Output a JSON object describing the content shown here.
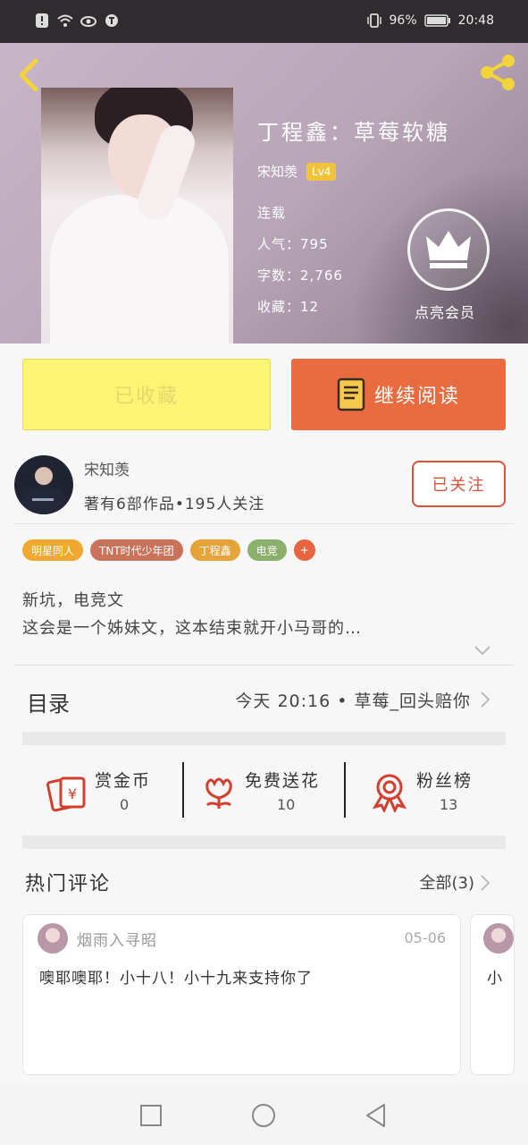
{
  "status_bar": {
    "battery": "96%",
    "time": "20:48"
  },
  "book": {
    "title": "丁程鑫：草莓软糖",
    "author": "宋知羡",
    "level": "Lv4",
    "status": "连载",
    "popularity": "人气：795",
    "word_count": "字数：2,766",
    "favorites": "收藏：12",
    "vip_label": "点亮会员"
  },
  "actions": {
    "favorited_label": "已收藏",
    "read_label": "继续阅读"
  },
  "author_card": {
    "name": "宋知羡",
    "stats": "著有6部作品•195人关注",
    "follow_label": "已关注"
  },
  "tags": [
    {
      "label": "明星同人",
      "color": "#f0a830"
    },
    {
      "label": "TNT时代少年团",
      "color": "#c9735a"
    },
    {
      "label": "丁程鑫",
      "color": "#e5a43a"
    },
    {
      "label": "电竞",
      "color": "#8bb06b"
    },
    {
      "label": "+",
      "color": "#e8643f"
    }
  ],
  "description": {
    "line1": "新坑，电竞文",
    "line2": "这会是一个姊妹文，这本结束就开小马哥的…"
  },
  "toc": {
    "title": "目录",
    "latest": "今天 20:16 • 草莓_回头赔你"
  },
  "rewards": [
    {
      "label": "赏金币",
      "count": "0",
      "icon": "red-envelope-icon"
    },
    {
      "label": "免费送花",
      "count": "10",
      "icon": "flower-icon"
    },
    {
      "label": "粉丝榜",
      "count": "13",
      "icon": "medal-icon"
    }
  ],
  "comments": {
    "title": "热门评论",
    "all_label": "全部(3)",
    "items": [
      {
        "user": "烟雨入寻昭",
        "date": "05-06",
        "text": "噢耶噢耶！小十八！小十九来支持你了"
      },
      {
        "text": "小"
      }
    ]
  },
  "colors": {
    "accent": "#e86c3f",
    "favorite": "#fdf476",
    "follow": "#d9533c"
  }
}
